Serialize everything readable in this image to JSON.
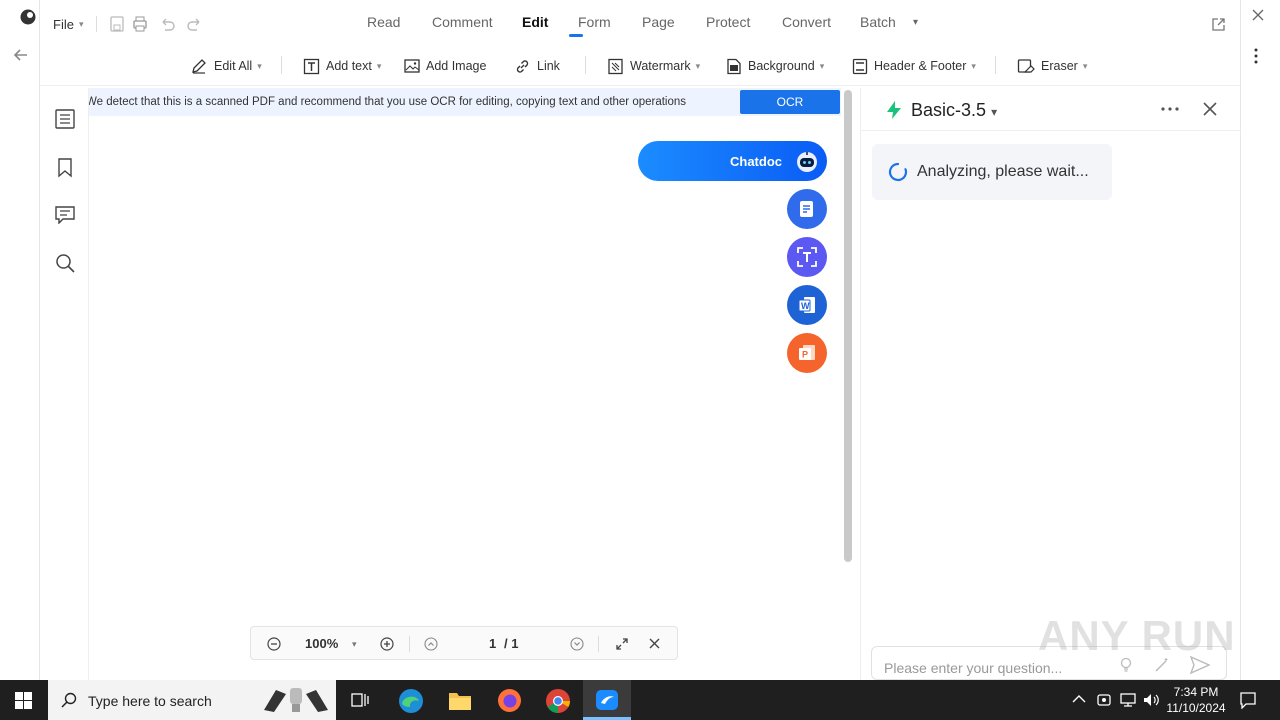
{
  "app": {
    "file_menu": "File",
    "menu_tabs": [
      "Read",
      "Comment",
      "Edit",
      "Form",
      "Page",
      "Protect",
      "Convert",
      "Batch"
    ],
    "active_tab": "Edit"
  },
  "toolbar": {
    "edit_all": "Edit All",
    "add_text": "Add text",
    "add_image": "Add Image",
    "link": "Link",
    "watermark": "Watermark",
    "background": "Background",
    "header_footer": "Header & Footer",
    "eraser": "Eraser"
  },
  "ocr_banner": {
    "message": "We detect that this is a scanned PDF and recommend that you use OCR for editing, copying text and other operations",
    "button": "OCR"
  },
  "chatdoc": {
    "label": "Chatdoc"
  },
  "zoom": {
    "level": "100%",
    "page_current": "1",
    "page_total": "/ 1"
  },
  "ai_panel": {
    "model": "Basic-3.5",
    "status": "Analyzing, please wait...",
    "input_placeholder": "Please enter your question..."
  },
  "taskbar": {
    "search_placeholder": "Type here to search",
    "time": "7:34 PM",
    "date": "11/10/2024"
  },
  "watermark_text": "ANY RUN",
  "colors": {
    "accent": "#1a73e8",
    "chatdoc_gradient_start": "#1b8cff",
    "fab_note": "#2f6bea",
    "fab_text": "#5b59f2",
    "fab_word": "#1e63d6",
    "fab_ppt": "#f4642c",
    "ai_bolt": "#19c37d"
  }
}
